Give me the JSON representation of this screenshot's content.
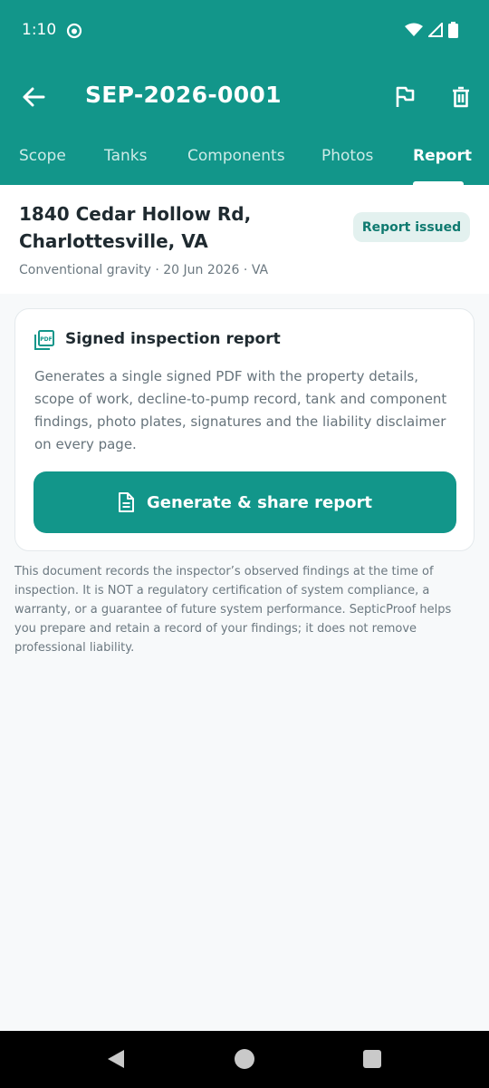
{
  "status_bar": {
    "time": "1:10"
  },
  "toolbar": {
    "title": "SEP-2026-0001"
  },
  "tabs": [
    {
      "label": "Scope"
    },
    {
      "label": "Tanks"
    },
    {
      "label": "Components"
    },
    {
      "label": "Photos"
    },
    {
      "label": "Report",
      "active": true
    }
  ],
  "property": {
    "address_line1": "1840 Cedar Hollow Rd,",
    "address_line2": "Charlottesville, VA",
    "meta": "Conventional gravity · 20 Jun 2026 · VA",
    "status_badge": "Report issued"
  },
  "report_card": {
    "title": "Signed inspection report",
    "description": "Generates a single signed PDF with the property details, scope of work, decline-to-pump record, tank and component findings, photo plates, signatures and the liability disclaimer on every page.",
    "button_label": "Generate & share report"
  },
  "disclaimer": "This document records the inspector’s observed findings at the time of inspection. It is NOT a regulatory certification of system compliance, a warranty, or a guarantee of future system performance. SepticProof helps you prepare and retain a record of your findings; it does not remove professional liability.",
  "colors": {
    "primary": "#12968a",
    "badge_bg": "#e3f1ef",
    "badge_text": "#0f7a70"
  },
  "icons": [
    "back-arrow-icon",
    "flag-icon",
    "trash-icon",
    "pdf-icon",
    "document-icon",
    "wifi-icon",
    "signal-icon",
    "battery-icon"
  ]
}
